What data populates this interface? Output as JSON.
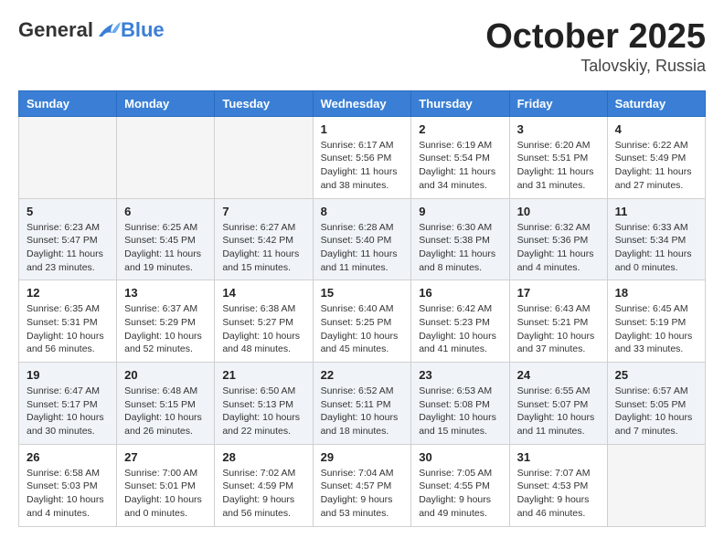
{
  "header": {
    "logo_general": "General",
    "logo_blue": "Blue",
    "month": "October 2025",
    "location": "Talovskiy, Russia"
  },
  "weekdays": [
    "Sunday",
    "Monday",
    "Tuesday",
    "Wednesday",
    "Thursday",
    "Friday",
    "Saturday"
  ],
  "weeks": [
    [
      {
        "day": "",
        "info": ""
      },
      {
        "day": "",
        "info": ""
      },
      {
        "day": "",
        "info": ""
      },
      {
        "day": "1",
        "info": "Sunrise: 6:17 AM\nSunset: 5:56 PM\nDaylight: 11 hours\nand 38 minutes."
      },
      {
        "day": "2",
        "info": "Sunrise: 6:19 AM\nSunset: 5:54 PM\nDaylight: 11 hours\nand 34 minutes."
      },
      {
        "day": "3",
        "info": "Sunrise: 6:20 AM\nSunset: 5:51 PM\nDaylight: 11 hours\nand 31 minutes."
      },
      {
        "day": "4",
        "info": "Sunrise: 6:22 AM\nSunset: 5:49 PM\nDaylight: 11 hours\nand 27 minutes."
      }
    ],
    [
      {
        "day": "5",
        "info": "Sunrise: 6:23 AM\nSunset: 5:47 PM\nDaylight: 11 hours\nand 23 minutes."
      },
      {
        "day": "6",
        "info": "Sunrise: 6:25 AM\nSunset: 5:45 PM\nDaylight: 11 hours\nand 19 minutes."
      },
      {
        "day": "7",
        "info": "Sunrise: 6:27 AM\nSunset: 5:42 PM\nDaylight: 11 hours\nand 15 minutes."
      },
      {
        "day": "8",
        "info": "Sunrise: 6:28 AM\nSunset: 5:40 PM\nDaylight: 11 hours\nand 11 minutes."
      },
      {
        "day": "9",
        "info": "Sunrise: 6:30 AM\nSunset: 5:38 PM\nDaylight: 11 hours\nand 8 minutes."
      },
      {
        "day": "10",
        "info": "Sunrise: 6:32 AM\nSunset: 5:36 PM\nDaylight: 11 hours\nand 4 minutes."
      },
      {
        "day": "11",
        "info": "Sunrise: 6:33 AM\nSunset: 5:34 PM\nDaylight: 11 hours\nand 0 minutes."
      }
    ],
    [
      {
        "day": "12",
        "info": "Sunrise: 6:35 AM\nSunset: 5:31 PM\nDaylight: 10 hours\nand 56 minutes."
      },
      {
        "day": "13",
        "info": "Sunrise: 6:37 AM\nSunset: 5:29 PM\nDaylight: 10 hours\nand 52 minutes."
      },
      {
        "day": "14",
        "info": "Sunrise: 6:38 AM\nSunset: 5:27 PM\nDaylight: 10 hours\nand 48 minutes."
      },
      {
        "day": "15",
        "info": "Sunrise: 6:40 AM\nSunset: 5:25 PM\nDaylight: 10 hours\nand 45 minutes."
      },
      {
        "day": "16",
        "info": "Sunrise: 6:42 AM\nSunset: 5:23 PM\nDaylight: 10 hours\nand 41 minutes."
      },
      {
        "day": "17",
        "info": "Sunrise: 6:43 AM\nSunset: 5:21 PM\nDaylight: 10 hours\nand 37 minutes."
      },
      {
        "day": "18",
        "info": "Sunrise: 6:45 AM\nSunset: 5:19 PM\nDaylight: 10 hours\nand 33 minutes."
      }
    ],
    [
      {
        "day": "19",
        "info": "Sunrise: 6:47 AM\nSunset: 5:17 PM\nDaylight: 10 hours\nand 30 minutes."
      },
      {
        "day": "20",
        "info": "Sunrise: 6:48 AM\nSunset: 5:15 PM\nDaylight: 10 hours\nand 26 minutes."
      },
      {
        "day": "21",
        "info": "Sunrise: 6:50 AM\nSunset: 5:13 PM\nDaylight: 10 hours\nand 22 minutes."
      },
      {
        "day": "22",
        "info": "Sunrise: 6:52 AM\nSunset: 5:11 PM\nDaylight: 10 hours\nand 18 minutes."
      },
      {
        "day": "23",
        "info": "Sunrise: 6:53 AM\nSunset: 5:08 PM\nDaylight: 10 hours\nand 15 minutes."
      },
      {
        "day": "24",
        "info": "Sunrise: 6:55 AM\nSunset: 5:07 PM\nDaylight: 10 hours\nand 11 minutes."
      },
      {
        "day": "25",
        "info": "Sunrise: 6:57 AM\nSunset: 5:05 PM\nDaylight: 10 hours\nand 7 minutes."
      }
    ],
    [
      {
        "day": "26",
        "info": "Sunrise: 6:58 AM\nSunset: 5:03 PM\nDaylight: 10 hours\nand 4 minutes."
      },
      {
        "day": "27",
        "info": "Sunrise: 7:00 AM\nSunset: 5:01 PM\nDaylight: 10 hours\nand 0 minutes."
      },
      {
        "day": "28",
        "info": "Sunrise: 7:02 AM\nSunset: 4:59 PM\nDaylight: 9 hours\nand 56 minutes."
      },
      {
        "day": "29",
        "info": "Sunrise: 7:04 AM\nSunset: 4:57 PM\nDaylight: 9 hours\nand 53 minutes."
      },
      {
        "day": "30",
        "info": "Sunrise: 7:05 AM\nSunset: 4:55 PM\nDaylight: 9 hours\nand 49 minutes."
      },
      {
        "day": "31",
        "info": "Sunrise: 7:07 AM\nSunset: 4:53 PM\nDaylight: 9 hours\nand 46 minutes."
      },
      {
        "day": "",
        "info": ""
      }
    ]
  ]
}
